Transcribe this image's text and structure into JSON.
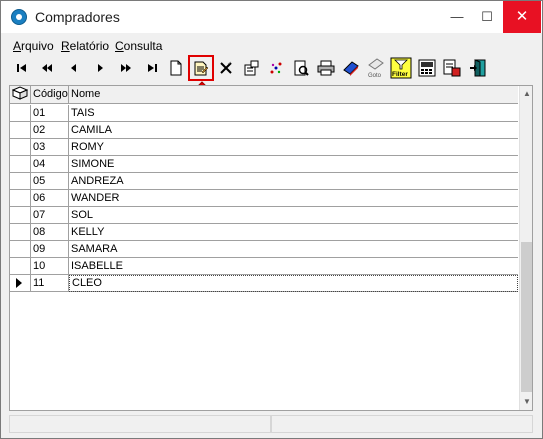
{
  "window": {
    "title": "Compradores",
    "minimize_glyph": "—",
    "maximize_glyph": "☐",
    "close_glyph": "✕"
  },
  "menu": [
    {
      "label": "Arquivo",
      "accel": "A",
      "rest": "rquivo"
    },
    {
      "label": "Relatório",
      "accel": "R",
      "rest": "elatório"
    },
    {
      "label": "Consulta",
      "accel": "C",
      "rest": "onsulta"
    }
  ],
  "toolbar": {
    "buttons": [
      {
        "name": "first-record-button",
        "icon": "first-icon"
      },
      {
        "name": "prior-page-button",
        "icon": "rewind-icon"
      },
      {
        "name": "prior-record-button",
        "icon": "prior-icon"
      },
      {
        "name": "next-record-button",
        "icon": "next-icon"
      },
      {
        "name": "next-page-button",
        "icon": "fast-forward-icon"
      },
      {
        "name": "last-record-button",
        "icon": "last-icon"
      },
      {
        "name": "new-record-button",
        "icon": "new-document-icon"
      },
      {
        "name": "edit-record-button",
        "icon": "edit-document-icon"
      },
      {
        "name": "delete-record-button",
        "icon": "delete-x-icon"
      },
      {
        "name": "properties-button",
        "icon": "properties-icon"
      },
      {
        "name": "refresh-button",
        "icon": "sparkle-icon"
      },
      {
        "name": "report-button",
        "icon": "report-icon"
      },
      {
        "name": "search-button",
        "icon": "magnifier-document-icon"
      },
      {
        "name": "print-button",
        "icon": "printer-icon"
      },
      {
        "name": "bookmark-button",
        "icon": "bookmark-icon"
      },
      {
        "name": "goto-button",
        "icon": "goto-icon"
      },
      {
        "name": "filter-button",
        "icon": "filter-icon"
      },
      {
        "name": "calculator-button",
        "icon": "calculator-icon"
      },
      {
        "name": "export-button",
        "icon": "export-icon"
      },
      {
        "name": "exit-button",
        "icon": "exit-door-icon"
      }
    ],
    "goto_label": "Goto",
    "filter_label": "Filter"
  },
  "grid": {
    "columns": [
      "Código",
      "Nome"
    ],
    "rows": [
      {
        "codigo": "01",
        "nome": "TAIS"
      },
      {
        "codigo": "02",
        "nome": "CAMILA"
      },
      {
        "codigo": "03",
        "nome": "ROMY"
      },
      {
        "codigo": "04",
        "nome": "SIMONE"
      },
      {
        "codigo": "05",
        "nome": "ANDREZA"
      },
      {
        "codigo": "06",
        "nome": "WANDER"
      },
      {
        "codigo": "07",
        "nome": "SOL"
      },
      {
        "codigo": "08",
        "nome": "KELLY"
      },
      {
        "codigo": "09",
        "nome": "SAMARA"
      },
      {
        "codigo": "10",
        "nome": "ISABELLE"
      },
      {
        "codigo": "11",
        "nome": "CLEO"
      }
    ],
    "current_row": 11
  },
  "colors": {
    "close_button": "#e81123",
    "highlight_outline": "#e00000",
    "arrow_marker": "#e00000"
  }
}
